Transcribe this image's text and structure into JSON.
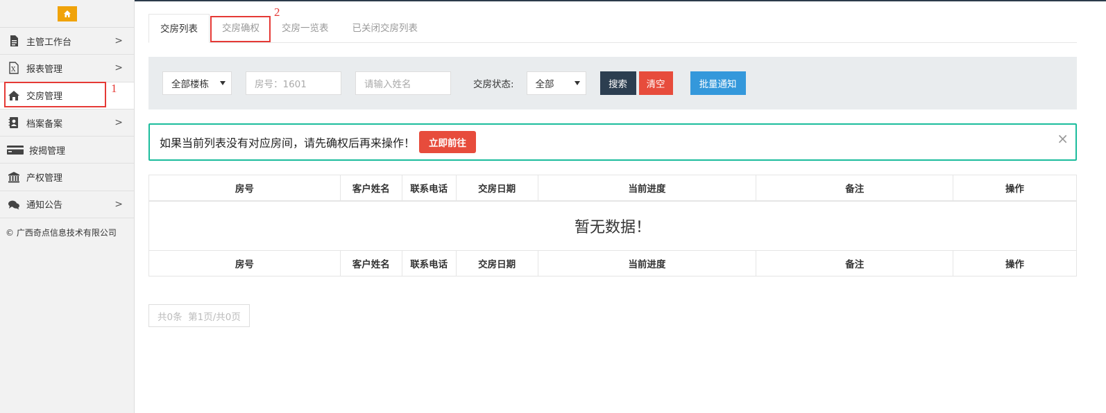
{
  "sidebar": {
    "items": [
      {
        "label": "主管工作台",
        "icon": "file-icon",
        "has_chevron": true
      },
      {
        "label": "报表管理",
        "icon": "excel-icon",
        "has_chevron": true
      },
      {
        "label": "交房管理",
        "icon": "home-icon",
        "has_chevron": false
      },
      {
        "label": "档案备案",
        "icon": "contact-book-icon",
        "has_chevron": true
      },
      {
        "label": "按揭管理",
        "icon": "credit-card-icon",
        "has_chevron": false
      },
      {
        "label": "产权管理",
        "icon": "bank-icon",
        "has_chevron": false
      },
      {
        "label": "通知公告",
        "icon": "comments-icon",
        "has_chevron": true
      }
    ],
    "copyright": "© 广西奇点信息技术有限公司"
  },
  "annotations": {
    "one": "1",
    "two": "2"
  },
  "tabs": [
    {
      "label": "交房列表"
    },
    {
      "label": "交房确权"
    },
    {
      "label": "交房一览表"
    },
    {
      "label": "已关闭交房列表"
    }
  ],
  "filter": {
    "building_select": "全部楼栋",
    "room_placeholder": "房号：1601",
    "name_placeholder": "请输入姓名",
    "status_label": "交房状态:",
    "status_select": "全部",
    "search": "搜索",
    "clear": "清空",
    "batch_notify": "批量通知"
  },
  "alert": {
    "message": "如果当前列表没有对应房间，请先确权后再来操作！",
    "go": "立即前往",
    "close": "×"
  },
  "table": {
    "columns": [
      "房号",
      "客户姓名",
      "联系电话",
      "交房日期",
      "当前进度",
      "备注",
      "操作"
    ],
    "empty": "暂无数据！"
  },
  "pager": {
    "text": "共0条  第1页/共0页"
  },
  "colors": {
    "accent": "#f0a30a",
    "teal": "#1abc9c",
    "red": "#e74c3c",
    "dark": "#2c3e50",
    "blue": "#3498db"
  }
}
